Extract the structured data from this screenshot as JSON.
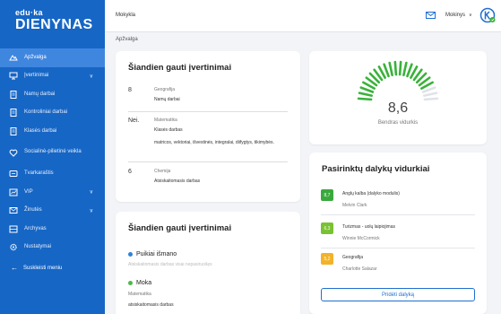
{
  "app": {
    "logo_small": "edu·ka",
    "logo_big": "DIENYNAS",
    "school": "Mokykla",
    "user": "Mokinys",
    "user_chevron": "∨",
    "avatar_icon": "k-avatar-icon"
  },
  "breadcrumb": "Apžvalga",
  "sidebar": {
    "items": [
      {
        "label": "Apžvalga",
        "icon": "dashboard-icon"
      },
      {
        "label": "Įvertinimai",
        "icon": "monitor-icon",
        "chevron": "∨"
      },
      {
        "label": "Namų darbai",
        "icon": "document-icon"
      },
      {
        "label": "Kontroliniai darbai",
        "icon": "document-icon"
      },
      {
        "label": "Klasės darbai",
        "icon": "document-icon"
      },
      {
        "label": "Socialinė-pilietinė veikla",
        "icon": "heart-icon"
      },
      {
        "label": "Tvarkaraštis",
        "icon": "calendar-icon"
      },
      {
        "label": "VIP",
        "icon": "chart-icon",
        "chevron": "∨"
      },
      {
        "label": "Žinutės",
        "icon": "mail-icon",
        "chevron": "∨"
      },
      {
        "label": "Archyvas",
        "icon": "archive-icon"
      },
      {
        "label": "Nustatymai",
        "icon": "gear-icon"
      }
    ],
    "collapse_label": "Suskleisti meniu",
    "collapse_icon": "←"
  },
  "today_grades": {
    "title": "Šiandien gauti įvertinimai",
    "rows": [
      {
        "value": "8",
        "subject": "Geografija",
        "type": "Namų darbai",
        "desc": ""
      },
      {
        "value": "Nei.",
        "subject": "Matematika",
        "type": "Klasės darbas",
        "desc": "matricos, vektoriai, išvestinės, integralai, diifygtys, tikimybės."
      },
      {
        "value": "6",
        "subject": "Chemija",
        "type": "Atsiskaitomasis darbas",
        "desc": ""
      }
    ]
  },
  "today_levels": {
    "title": "Šiandien gauti įvertinimai",
    "level1": "Puikiai išmano",
    "level1_faint": "Atsiskaitomasis darbas visai nepasiruošęs",
    "level2": "Moka",
    "level2_subject": "Matematika",
    "level2_type": "atsiskaitomasis darbas",
    "level1_color": "#2f83d8",
    "level2_color": "#4fb848"
  },
  "overall": {
    "value": "8,6",
    "label": "Bendras vidurkis",
    "fraction": 0.86,
    "gauge_color": "#39b23a"
  },
  "subjects": {
    "title": "Pasirinktų dalykų vidurkiai",
    "items": [
      {
        "avg": "8,7",
        "name": "Anglų kalba (dalyko modulis)",
        "teacher": "Melvin Clark",
        "color": "#3aa93d"
      },
      {
        "avg": "6,3",
        "name": "Turizmas - uolų laipiojimas",
        "teacher": "Winnie McCormick",
        "color": "#79c232"
      },
      {
        "avg": "5,2",
        "name": "Geografija",
        "teacher": "Charlotte Salazar",
        "color": "#f2b32a"
      }
    ],
    "add_label": "Pridėti dalyką"
  }
}
